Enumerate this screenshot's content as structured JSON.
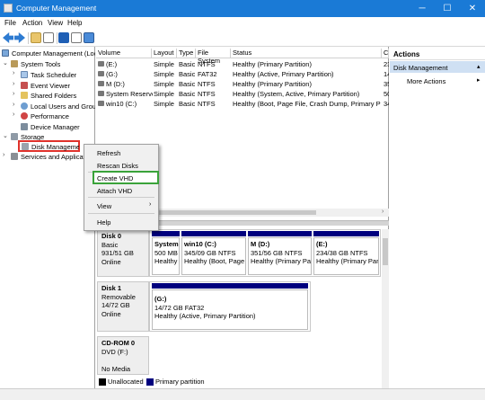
{
  "window": {
    "title": "Computer Management",
    "minimize": "─",
    "maximize": "☐",
    "close": "✕"
  },
  "menu": [
    "File",
    "Action",
    "View",
    "Help"
  ],
  "tree": {
    "root": "Computer Management (Local",
    "system_tools": "System Tools",
    "task_scheduler": "Task Scheduler",
    "event_viewer": "Event Viewer",
    "shared_folders": "Shared Folders",
    "local_users": "Local Users and Groups",
    "performance": "Performance",
    "device_manager": "Device Manager",
    "storage": "Storage",
    "disk_management": "Disk Management",
    "services": "Services and Applicatio"
  },
  "table": {
    "headers": [
      "Volume",
      "Layout",
      "Type",
      "File System",
      "Status",
      "C"
    ],
    "rows": [
      [
        "(E:)",
        "Simple",
        "Basic",
        "NTFS",
        "Healthy (Primary Partition)",
        "23"
      ],
      [
        "(G:)",
        "Simple",
        "Basic",
        "FAT32",
        "Healthy (Active, Primary Partition)",
        "14"
      ],
      [
        "M (D:)",
        "Simple",
        "Basic",
        "NTFS",
        "Healthy (Primary Partition)",
        "35"
      ],
      [
        "System Reserved",
        "Simple",
        "Basic",
        "NTFS",
        "Healthy (System, Active, Primary Partition)",
        "50"
      ],
      [
        "win10 (C:)",
        "Simple",
        "Basic",
        "NTFS",
        "Healthy (Boot, Page File, Crash Dump, Primary Partition)",
        "34"
      ]
    ]
  },
  "disks": [
    {
      "name": "Disk 0",
      "type": "Basic",
      "size": "931/51 GB",
      "status": "Online",
      "parts": [
        {
          "name": "System R",
          "size": "500 MB N",
          "status": "Healthy ("
        },
        {
          "name": "win10  (C:)",
          "size": "345/09 GB NTFS",
          "status": "Healthy (Boot, Page Fil"
        },
        {
          "name": "M  (D:)",
          "size": "351/56 GB NTFS",
          "status": "Healthy (Primary Partit"
        },
        {
          "name": "(E:)",
          "size": "234/38 GB NTFS",
          "status": "Healthy (Primary Partit"
        }
      ]
    },
    {
      "name": "Disk 1",
      "type": "Removable",
      "size": "14/72 GB",
      "status": "Online",
      "parts": [
        {
          "name": "(G:)",
          "size": "14/72 GB FAT32",
          "status": "Healthy (Active, Primary Partition)"
        }
      ]
    },
    {
      "name": "CD-ROM 0",
      "type": "DVD (F:)",
      "size": "",
      "status": "No Media",
      "parts": []
    }
  ],
  "legend": {
    "unallocated": "Unallocated",
    "primary": "Primary partition"
  },
  "actions": {
    "header": "Actions",
    "section": "Disk Management",
    "more": "More Actions"
  },
  "context_menu": {
    "refresh": "Refresh",
    "rescan": "Rescan Disks",
    "create_vhd": "Create VHD",
    "attach_vhd": "Attach VHD",
    "view": "View",
    "help": "Help"
  },
  "colors": {
    "titlebar": "#1a7ad6",
    "partition_header": "#00007e",
    "highlight_red": "#e0322b",
    "highlight_green": "#3aa33a",
    "actions_section": "#cfe0f3"
  }
}
